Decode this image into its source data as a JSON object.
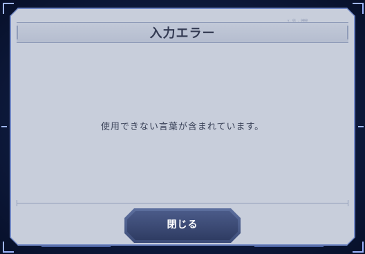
{
  "dialog": {
    "title": "入力エラー",
    "message": "使用できない言葉が含まれています。",
    "close_label": "閉じる",
    "corner_code": "v. 01 . 0000"
  },
  "colors": {
    "panel": "#c8cedb",
    "title_text": "#333a52",
    "message_text": "#3a4258",
    "button": "#3d4d79",
    "frame_glow": "#6f86c4"
  },
  "icons": [
    "frame-corner-icon",
    "frame-tick-icon"
  ]
}
